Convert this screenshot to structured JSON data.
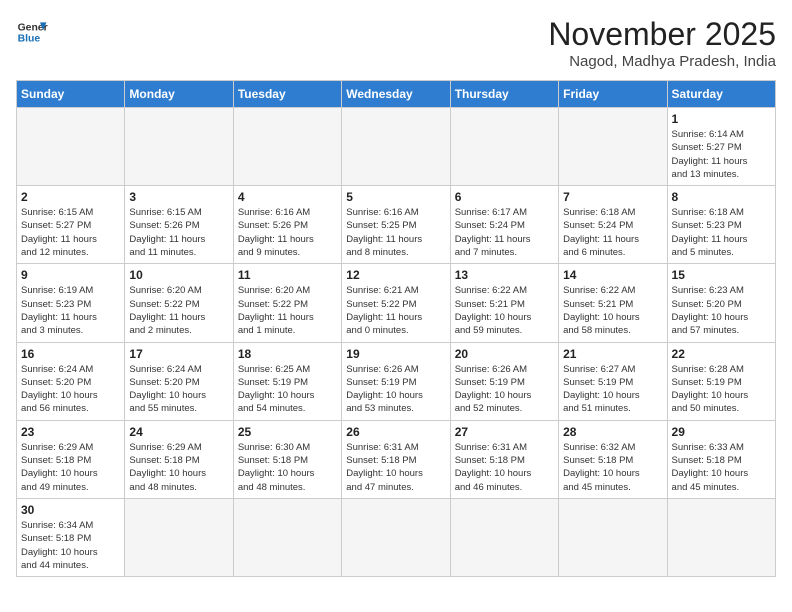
{
  "header": {
    "logo_general": "General",
    "logo_blue": "Blue",
    "month_year": "November 2025",
    "location": "Nagod, Madhya Pradesh, India"
  },
  "weekdays": [
    "Sunday",
    "Monday",
    "Tuesday",
    "Wednesday",
    "Thursday",
    "Friday",
    "Saturday"
  ],
  "weeks": [
    [
      {
        "day": "",
        "info": ""
      },
      {
        "day": "",
        "info": ""
      },
      {
        "day": "",
        "info": ""
      },
      {
        "day": "",
        "info": ""
      },
      {
        "day": "",
        "info": ""
      },
      {
        "day": "",
        "info": ""
      },
      {
        "day": "1",
        "info": "Sunrise: 6:14 AM\nSunset: 5:27 PM\nDaylight: 11 hours\nand 13 minutes."
      }
    ],
    [
      {
        "day": "2",
        "info": "Sunrise: 6:15 AM\nSunset: 5:27 PM\nDaylight: 11 hours\nand 12 minutes."
      },
      {
        "day": "3",
        "info": "Sunrise: 6:15 AM\nSunset: 5:26 PM\nDaylight: 11 hours\nand 11 minutes."
      },
      {
        "day": "4",
        "info": "Sunrise: 6:16 AM\nSunset: 5:26 PM\nDaylight: 11 hours\nand 9 minutes."
      },
      {
        "day": "5",
        "info": "Sunrise: 6:16 AM\nSunset: 5:25 PM\nDaylight: 11 hours\nand 8 minutes."
      },
      {
        "day": "6",
        "info": "Sunrise: 6:17 AM\nSunset: 5:24 PM\nDaylight: 11 hours\nand 7 minutes."
      },
      {
        "day": "7",
        "info": "Sunrise: 6:18 AM\nSunset: 5:24 PM\nDaylight: 11 hours\nand 6 minutes."
      },
      {
        "day": "8",
        "info": "Sunrise: 6:18 AM\nSunset: 5:23 PM\nDaylight: 11 hours\nand 5 minutes."
      }
    ],
    [
      {
        "day": "9",
        "info": "Sunrise: 6:19 AM\nSunset: 5:23 PM\nDaylight: 11 hours\nand 3 minutes."
      },
      {
        "day": "10",
        "info": "Sunrise: 6:20 AM\nSunset: 5:22 PM\nDaylight: 11 hours\nand 2 minutes."
      },
      {
        "day": "11",
        "info": "Sunrise: 6:20 AM\nSunset: 5:22 PM\nDaylight: 11 hours\nand 1 minute."
      },
      {
        "day": "12",
        "info": "Sunrise: 6:21 AM\nSunset: 5:22 PM\nDaylight: 11 hours\nand 0 minutes."
      },
      {
        "day": "13",
        "info": "Sunrise: 6:22 AM\nSunset: 5:21 PM\nDaylight: 10 hours\nand 59 minutes."
      },
      {
        "day": "14",
        "info": "Sunrise: 6:22 AM\nSunset: 5:21 PM\nDaylight: 10 hours\nand 58 minutes."
      },
      {
        "day": "15",
        "info": "Sunrise: 6:23 AM\nSunset: 5:20 PM\nDaylight: 10 hours\nand 57 minutes."
      }
    ],
    [
      {
        "day": "16",
        "info": "Sunrise: 6:24 AM\nSunset: 5:20 PM\nDaylight: 10 hours\nand 56 minutes."
      },
      {
        "day": "17",
        "info": "Sunrise: 6:24 AM\nSunset: 5:20 PM\nDaylight: 10 hours\nand 55 minutes."
      },
      {
        "day": "18",
        "info": "Sunrise: 6:25 AM\nSunset: 5:19 PM\nDaylight: 10 hours\nand 54 minutes."
      },
      {
        "day": "19",
        "info": "Sunrise: 6:26 AM\nSunset: 5:19 PM\nDaylight: 10 hours\nand 53 minutes."
      },
      {
        "day": "20",
        "info": "Sunrise: 6:26 AM\nSunset: 5:19 PM\nDaylight: 10 hours\nand 52 minutes."
      },
      {
        "day": "21",
        "info": "Sunrise: 6:27 AM\nSunset: 5:19 PM\nDaylight: 10 hours\nand 51 minutes."
      },
      {
        "day": "22",
        "info": "Sunrise: 6:28 AM\nSunset: 5:19 PM\nDaylight: 10 hours\nand 50 minutes."
      }
    ],
    [
      {
        "day": "23",
        "info": "Sunrise: 6:29 AM\nSunset: 5:18 PM\nDaylight: 10 hours\nand 49 minutes."
      },
      {
        "day": "24",
        "info": "Sunrise: 6:29 AM\nSunset: 5:18 PM\nDaylight: 10 hours\nand 48 minutes."
      },
      {
        "day": "25",
        "info": "Sunrise: 6:30 AM\nSunset: 5:18 PM\nDaylight: 10 hours\nand 48 minutes."
      },
      {
        "day": "26",
        "info": "Sunrise: 6:31 AM\nSunset: 5:18 PM\nDaylight: 10 hours\nand 47 minutes."
      },
      {
        "day": "27",
        "info": "Sunrise: 6:31 AM\nSunset: 5:18 PM\nDaylight: 10 hours\nand 46 minutes."
      },
      {
        "day": "28",
        "info": "Sunrise: 6:32 AM\nSunset: 5:18 PM\nDaylight: 10 hours\nand 45 minutes."
      },
      {
        "day": "29",
        "info": "Sunrise: 6:33 AM\nSunset: 5:18 PM\nDaylight: 10 hours\nand 45 minutes."
      }
    ],
    [
      {
        "day": "30",
        "info": "Sunrise: 6:34 AM\nSunset: 5:18 PM\nDaylight: 10 hours\nand 44 minutes."
      },
      {
        "day": "",
        "info": ""
      },
      {
        "day": "",
        "info": ""
      },
      {
        "day": "",
        "info": ""
      },
      {
        "day": "",
        "info": ""
      },
      {
        "day": "",
        "info": ""
      },
      {
        "day": "",
        "info": ""
      }
    ]
  ]
}
